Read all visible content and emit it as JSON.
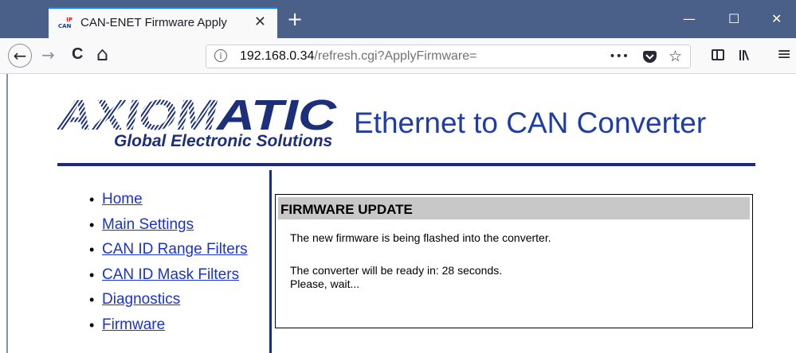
{
  "browser": {
    "tab": {
      "favicon_top": "IP",
      "favicon_bottom": "CAN",
      "title": "CAN-ENET Firmware Apply",
      "close": "✕"
    },
    "new_tab": "+",
    "window_controls": {
      "minimize": "—",
      "maximize": "☐",
      "close": "✕"
    },
    "nav": {
      "back": "←",
      "forward": "→",
      "reload": "C",
      "home": "⌂"
    },
    "url": {
      "info_icon": "i",
      "host": "192.168.0.34",
      "path": "/refresh.cgi?ApplyFirmware="
    },
    "url_actions": {
      "more": "•••",
      "pocket": "pocket-icon",
      "bookmark": "☆"
    },
    "toolbar_icons": {
      "sidebar": "sidebar-icon",
      "library": "library-icon",
      "menu": "≡"
    }
  },
  "page": {
    "logo_text": "AXIOMATIC",
    "logo_subtitle": "Global Electronic Solutions",
    "title": "Ethernet to CAN Converter",
    "nav_items": [
      "Home",
      "Main Settings",
      "CAN ID Range Filters",
      "CAN ID Mask Filters",
      "Diagnostics",
      "Firmware"
    ],
    "firmware": {
      "header": "FIRMWARE UPDATE",
      "line1": "The new firmware is being flashed into the converter.",
      "line2": "The converter will be ready in: 28 seconds.",
      "line3": "Please, wait..."
    }
  },
  "colors": {
    "titlebar": "#4a6089",
    "brand_blue": "#1b2a83",
    "title_blue": "#1e3da6",
    "link": "#1b33cc"
  }
}
